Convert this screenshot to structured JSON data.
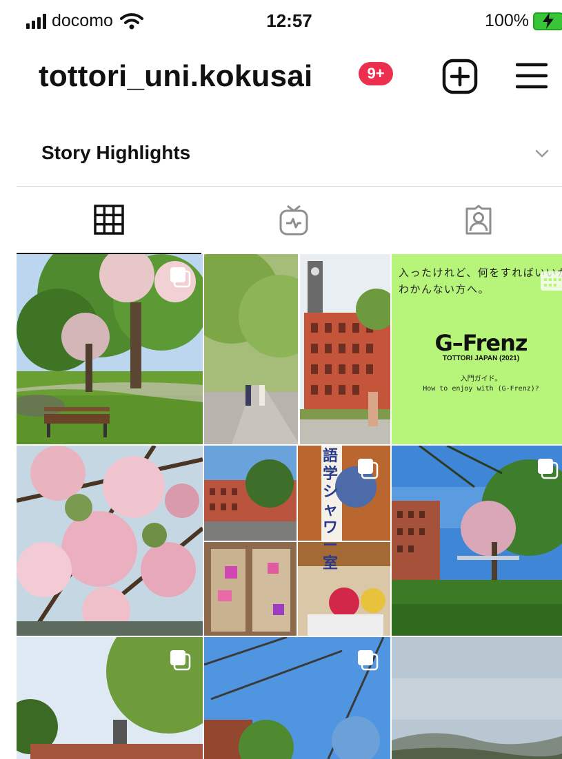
{
  "status_bar": {
    "carrier": "docomo",
    "time": "12:57",
    "battery": "100%"
  },
  "profile": {
    "username": "tottori_uni.kokusai",
    "notification_badge": "9+"
  },
  "story_highlights": {
    "title": "Story Highlights"
  },
  "tabs": [
    {
      "name": "posts-grid",
      "active": true
    },
    {
      "name": "igtv",
      "active": false
    },
    {
      "name": "tagged",
      "active": false
    }
  ],
  "posts": {
    "gfrenz_post": {
      "line1": "入ったけれど、何をすればいいか",
      "line2": "わかんない方へ。",
      "logo": "G–Frenz",
      "subtitle": "TOTTORI JAPAN (2021)",
      "caption_jp": "入門ガイド。",
      "caption_en": "How to enjoy with (G-Frenz)?"
    },
    "language_shower_sign": "語学シャワー室"
  },
  "colors": {
    "badge": "#ed2f4f",
    "gfrenz_bg": "#b7f57a",
    "battery": "#39c53a"
  }
}
